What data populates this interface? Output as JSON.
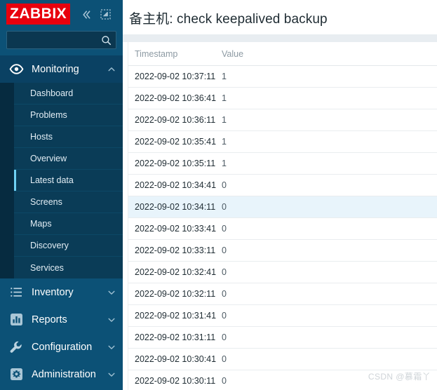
{
  "sidebar": {
    "logo_text": "ZABBIX",
    "collapse_icon": "chevron-double-left-icon",
    "kiosk_icon": "kiosk-expand-icon",
    "search": {
      "value": "",
      "placeholder": "",
      "icon": "search-icon"
    },
    "groups": [
      {
        "label": "Monitoring",
        "icon": "eye-icon",
        "expanded": true,
        "chevron": "chevron-up-icon",
        "items": [
          {
            "label": "Dashboard",
            "active": false
          },
          {
            "label": "Problems",
            "active": false
          },
          {
            "label": "Hosts",
            "active": false
          },
          {
            "label": "Overview",
            "active": false
          },
          {
            "label": "Latest data",
            "active": true
          },
          {
            "label": "Screens",
            "active": false
          },
          {
            "label": "Maps",
            "active": false
          },
          {
            "label": "Discovery",
            "active": false
          },
          {
            "label": "Services",
            "active": false
          }
        ]
      },
      {
        "label": "Inventory",
        "icon": "list-icon",
        "expanded": false,
        "chevron": "chevron-down-icon",
        "items": []
      },
      {
        "label": "Reports",
        "icon": "bar-chart-icon",
        "expanded": false,
        "chevron": "chevron-down-icon",
        "items": []
      },
      {
        "label": "Configuration",
        "icon": "wrench-icon",
        "expanded": false,
        "chevron": "chevron-down-icon",
        "items": []
      },
      {
        "label": "Administration",
        "icon": "gear-icon",
        "expanded": false,
        "chevron": "chevron-down-icon",
        "items": []
      }
    ]
  },
  "main": {
    "page_title": "备主机: check keepalived backup",
    "table": {
      "columns": [
        "Timestamp",
        "Value"
      ],
      "rows": [
        {
          "timestamp": "2022-09-02 10:37:11",
          "value": "1",
          "highlighted": false
        },
        {
          "timestamp": "2022-09-02 10:36:41",
          "value": "1",
          "highlighted": false
        },
        {
          "timestamp": "2022-09-02 10:36:11",
          "value": "1",
          "highlighted": false
        },
        {
          "timestamp": "2022-09-02 10:35:41",
          "value": "1",
          "highlighted": false
        },
        {
          "timestamp": "2022-09-02 10:35:11",
          "value": "1",
          "highlighted": false
        },
        {
          "timestamp": "2022-09-02 10:34:41",
          "value": "0",
          "highlighted": false
        },
        {
          "timestamp": "2022-09-02 10:34:11",
          "value": "0",
          "highlighted": true
        },
        {
          "timestamp": "2022-09-02 10:33:41",
          "value": "0",
          "highlighted": false
        },
        {
          "timestamp": "2022-09-02 10:33:11",
          "value": "0",
          "highlighted": false
        },
        {
          "timestamp": "2022-09-02 10:32:41",
          "value": "0",
          "highlighted": false
        },
        {
          "timestamp": "2022-09-02 10:32:11",
          "value": "0",
          "highlighted": false
        },
        {
          "timestamp": "2022-09-02 10:31:41",
          "value": "0",
          "highlighted": false
        },
        {
          "timestamp": "2022-09-02 10:31:11",
          "value": "0",
          "highlighted": false
        },
        {
          "timestamp": "2022-09-02 10:30:41",
          "value": "0",
          "highlighted": false
        },
        {
          "timestamp": "2022-09-02 10:30:11",
          "value": "0",
          "highlighted": false
        }
      ]
    },
    "watermark": "CSDN @慕霜丫"
  },
  "colors": {
    "sidebar_bg": "#0c5176",
    "submenu_bg": "#0a3c57",
    "submenu_rail": "#062b40",
    "logo_red": "#e8000d",
    "active_bar": "#6fd2f5",
    "row_highlight": "#e8f4fb",
    "strip": "#e8edf1"
  }
}
